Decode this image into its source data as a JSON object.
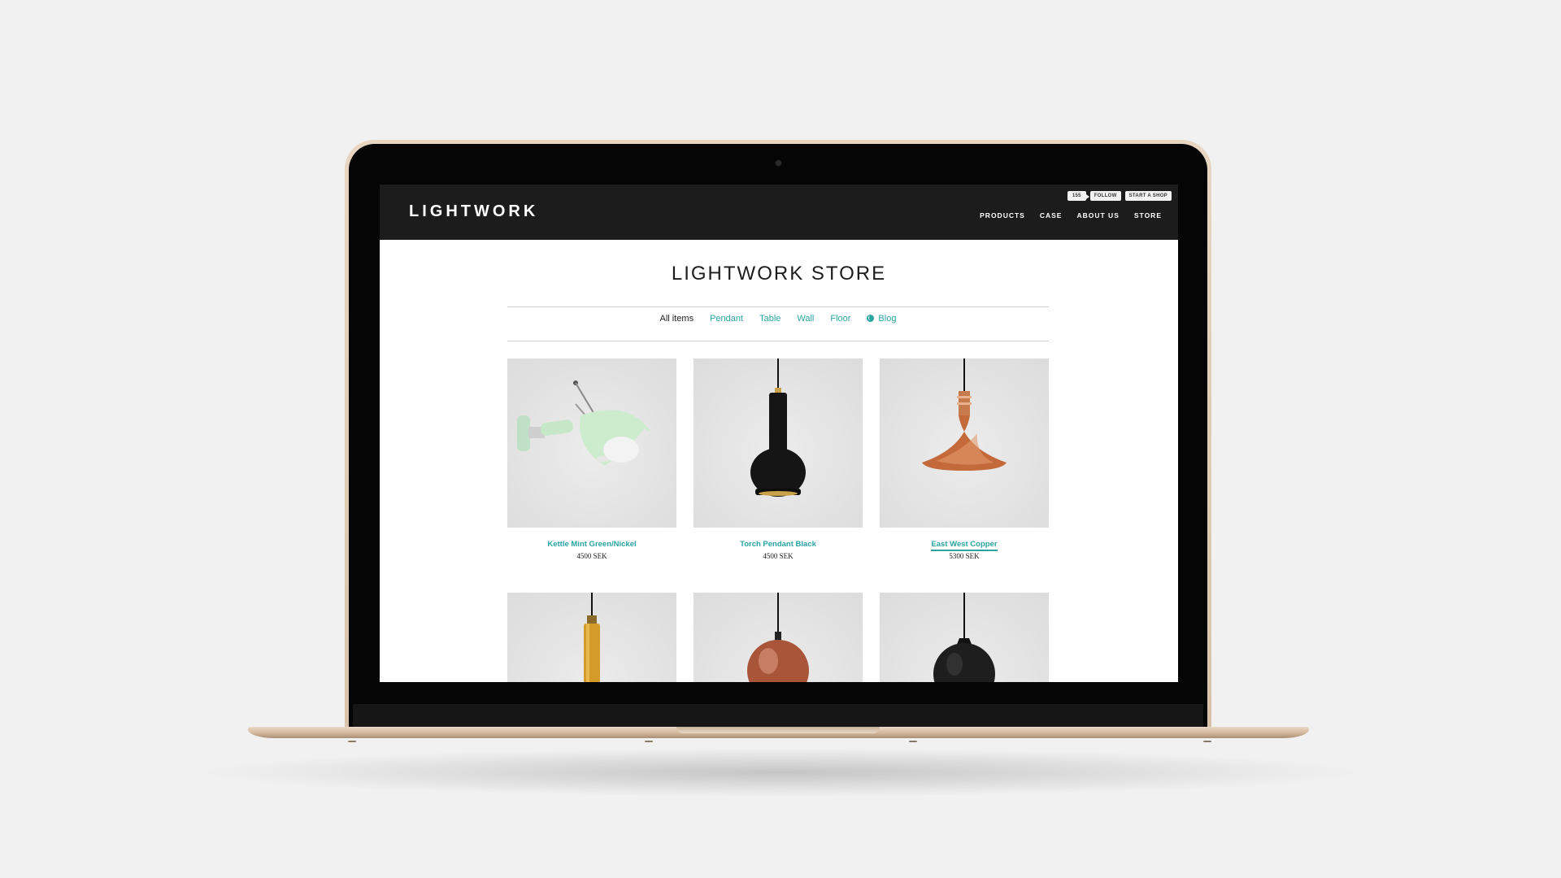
{
  "header": {
    "logo": "LIGHTWORK",
    "follow_count": "155",
    "follow_label": "FOLLOW",
    "start_shop_label": "START A SHOP",
    "nav": [
      "PRODUCTS",
      "CASE",
      "ABOUT US",
      "STORE"
    ]
  },
  "page": {
    "title": "LIGHTWORK STORE"
  },
  "filters": {
    "items": [
      "All items",
      "Pendant",
      "Table",
      "Wall",
      "Floor",
      "Blog"
    ],
    "active": "All items"
  },
  "products": [
    {
      "name": "Kettle Mint Green/Nickel",
      "price": "4500 SEK"
    },
    {
      "name": "Torch Pendant Black",
      "price": "4500 SEK"
    },
    {
      "name": "East West Copper",
      "price": "5300 SEK"
    },
    {
      "name": "",
      "price": ""
    },
    {
      "name": "",
      "price": ""
    },
    {
      "name": "",
      "price": ""
    }
  ],
  "colors": {
    "accent": "#2aa3a3",
    "header_bg": "#1c1c1c",
    "laptop_gold": "#d9c2a8"
  }
}
